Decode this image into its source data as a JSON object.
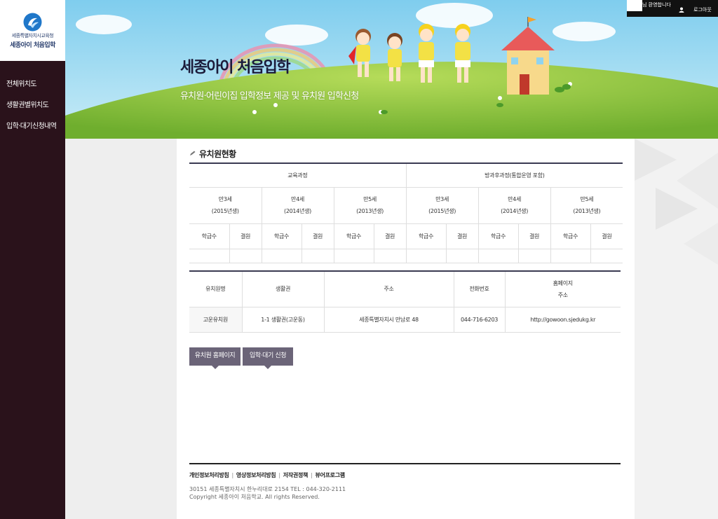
{
  "logo": {
    "org": "세종특별자치시교육청",
    "service": "세종아이 처음입학"
  },
  "sidebar": {
    "items": [
      {
        "label": "전체위치도"
      },
      {
        "label": "생활권별위치도"
      },
      {
        "label": "입학·대기신청내역"
      }
    ]
  },
  "topbar": {
    "welcome": "님 환영합니다",
    "logout": "로그아웃"
  },
  "banner": {
    "title": "세종아이 처음입학",
    "subtitle": "유치원·어린이집 입학정보 제공 및 유치원 입학신청"
  },
  "section": {
    "title": "유치원현황"
  },
  "table1": {
    "groups": [
      "교육과정",
      "방과후과정(통합운영 포함)"
    ],
    "ages": [
      {
        "age": "만3세",
        "year": "(2015년생)"
      },
      {
        "age": "만4세",
        "year": "(2014년생)"
      },
      {
        "age": "만5세",
        "year": "(2013년생)"
      },
      {
        "age": "만3세",
        "year": "(2015년생)"
      },
      {
        "age": "만4세",
        "year": "(2014년생)"
      },
      {
        "age": "만5세",
        "year": "(2013년생)"
      }
    ],
    "sub_headers": [
      "학급수",
      "결원"
    ]
  },
  "table2": {
    "headers": {
      "name": "유치원명",
      "zone": "생활권",
      "address": "주소",
      "phone": "전화번호",
      "homepage_1": "홈페이지",
      "homepage_2": "주소"
    },
    "row": {
      "name": "고운유치원",
      "zone": "1-1 생활권(고운동)",
      "address": "세종특별자치시 만남로 48",
      "phone": "044-716-6203",
      "homepage": "http://gowoon.sjedukg.kr"
    }
  },
  "buttons": {
    "homepage": "유치원 홈페이지",
    "apply": "입학·대기 신청"
  },
  "footer": {
    "links": [
      "개인정보처리방침",
      "영상정보처리방침",
      "저작권정책",
      "뷰어프로그램"
    ],
    "address": "30151 세종특별자치시 한누리대로 2154  TEL : 044-320-2111",
    "copyright": "Copyright 세종아이 처음학교. All rights Reserved."
  },
  "colors": {
    "sidebar_bg": "#2a121b",
    "button_bg": "#6b6478",
    "table_top_border": "#3a3a52",
    "banner_sky": "#8fd3ef",
    "banner_grass": "#8cc63f"
  }
}
